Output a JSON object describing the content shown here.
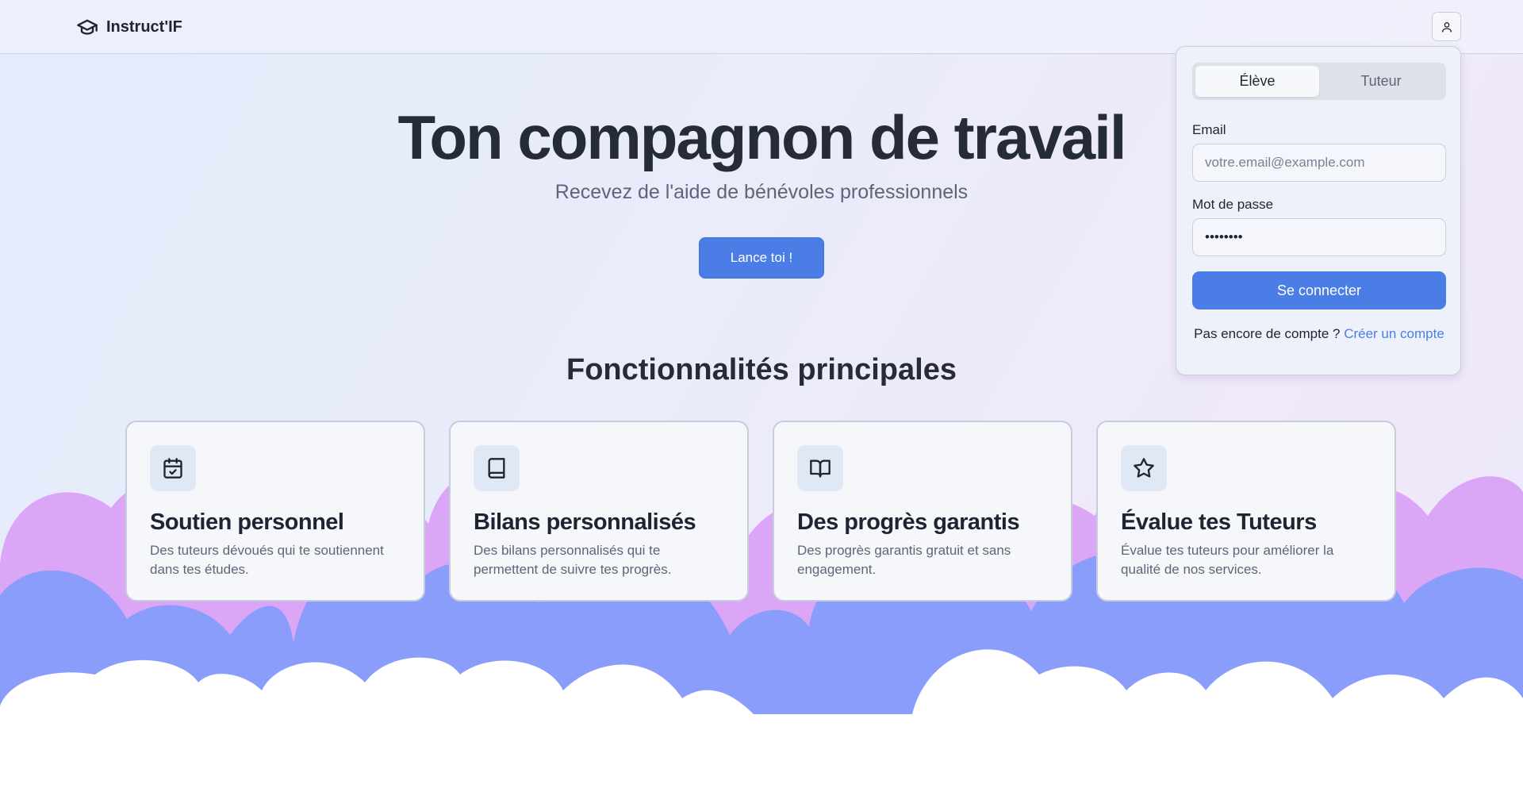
{
  "header": {
    "brand": "Instruct'IF",
    "brand_icon": "graduation-cap-icon",
    "user_icon": "user-icon"
  },
  "hero": {
    "title": "Ton compagnon de travail",
    "subtitle": "Recevez de l'aide de bénévoles professionnels",
    "cta_label": "Lance toi !"
  },
  "features": {
    "title": "Fonctionnalités principales",
    "cards": [
      {
        "icon": "calendar-check-icon",
        "title": "Soutien personnel",
        "desc": "Des tuteurs dévoués qui te soutiennent dans tes études."
      },
      {
        "icon": "book-icon",
        "title": "Bilans personnalisés",
        "desc": "Des bilans personnalisés qui te permettent de suivre tes progrès."
      },
      {
        "icon": "book-open-icon",
        "title": "Des progrès garantis",
        "desc": "Des progrès garantis gratuit et sans engagement."
      },
      {
        "icon": "star-icon",
        "title": "Évalue tes Tuteurs",
        "desc": "Évalue tes tuteurs pour améliorer la qualité de nos services."
      }
    ]
  },
  "login": {
    "tabs": [
      "Élève",
      "Tuteur"
    ],
    "active_tab": "Élève",
    "email_label": "Email",
    "email_placeholder": "votre.email@example.com",
    "email_value": "",
    "password_label": "Mot de passe",
    "password_value": "••••••••",
    "submit_label": "Se connecter",
    "signup_prompt": "Pas encore de compte ?",
    "signup_link": "Créer un compte"
  },
  "colors": {
    "accent": "#4a7ee6",
    "cloud_pink": "#dca6f7",
    "cloud_blue": "#8a9dfb",
    "cloud_white": "#ffffff"
  }
}
